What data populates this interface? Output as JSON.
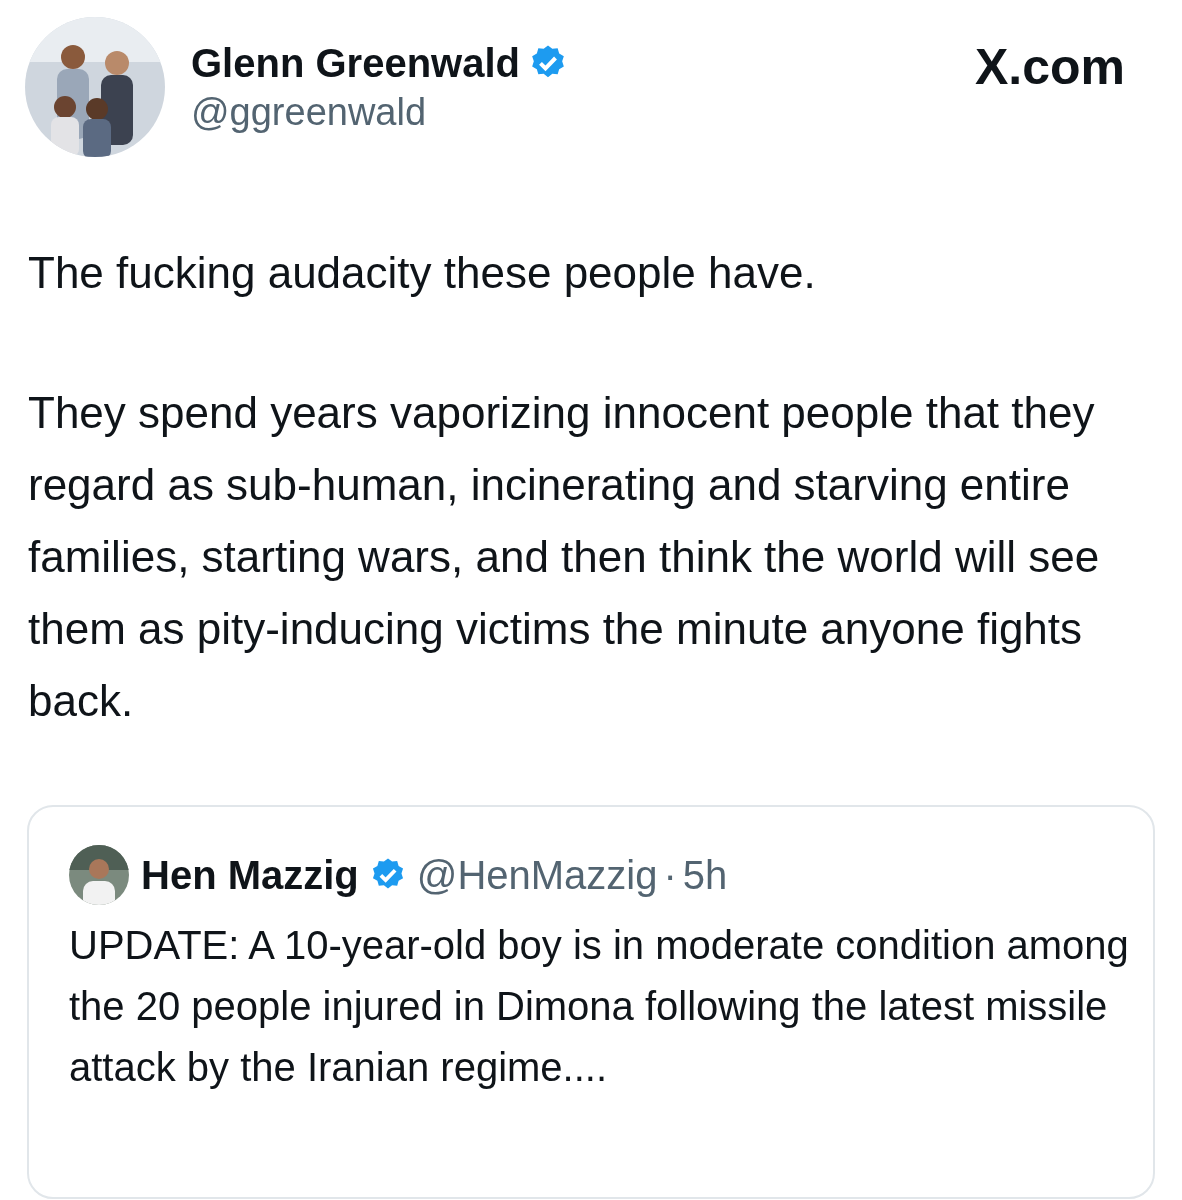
{
  "author": {
    "name": "Glenn Greenwald",
    "verified": true,
    "handle": "@ggreenwald"
  },
  "site": "X.com",
  "paragraphs": [
    "The fucking audacity these people have.",
    "They spend years vaporizing innocent people that they regard as sub-human, incinerating and starving entire families, starting wars, and then think the world will see them as pity-inducing victims the minute anyone fights back."
  ],
  "quote": {
    "name": "Hen Mazzig",
    "verified": true,
    "handle": "@HenMazzig",
    "separator": "·",
    "time": "5h",
    "text": "UPDATE: A 10-year-old boy is in moderate condition among the 20 people injured in Dimona following the latest missile attack by the Iranian regime...."
  }
}
